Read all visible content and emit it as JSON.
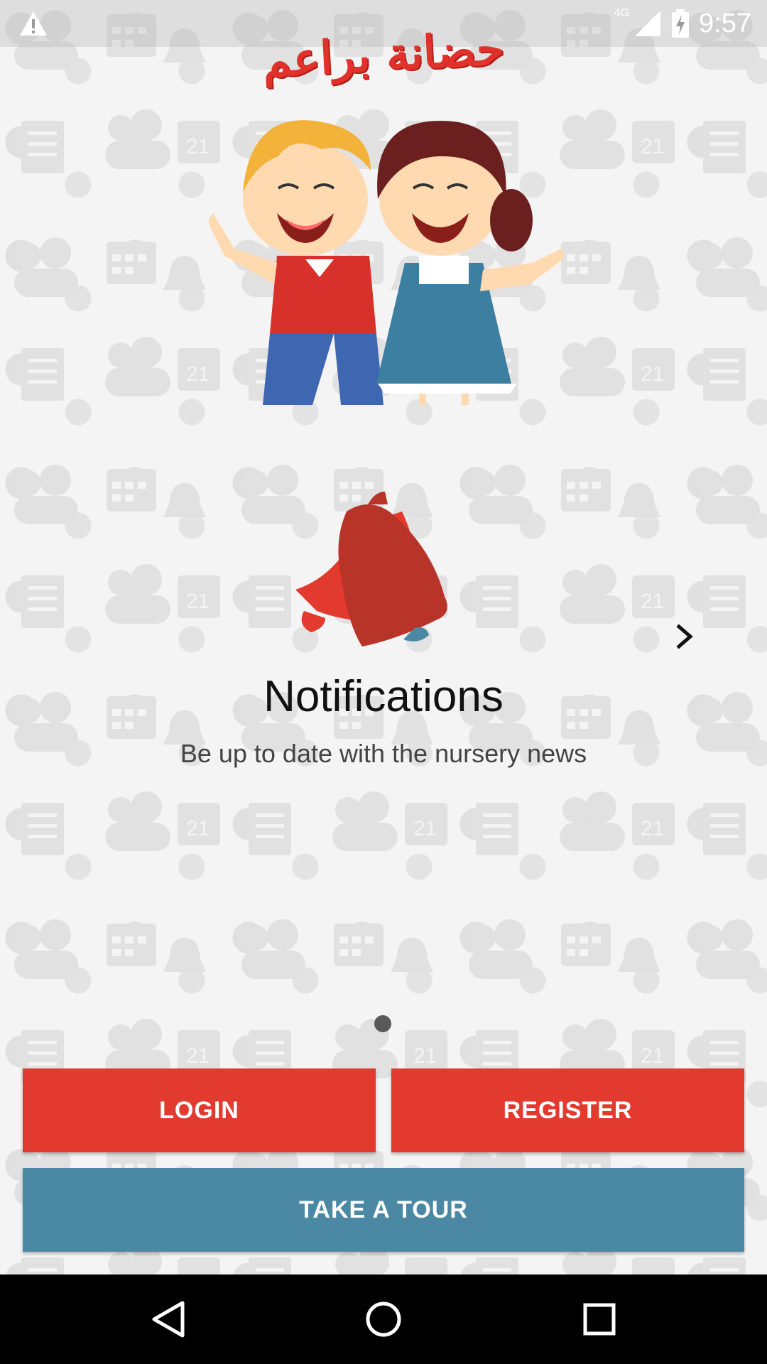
{
  "status_bar": {
    "network": "4G",
    "time": "9:57",
    "icons": [
      "warning-icon",
      "signal-icon",
      "battery-charging-icon"
    ]
  },
  "hero": {
    "app_title_ar": "حضانة براعم",
    "illustration": "kids-illustration"
  },
  "slide": {
    "icon": "bell-icon",
    "title": "Notifications",
    "subtitle": "Be up to date with the nursery news",
    "next_icon": "chevron-right-icon"
  },
  "pager": {
    "current": 1,
    "total": 1
  },
  "actions": {
    "login_label": "LOGIN",
    "register_label": "REGISTER",
    "tour_label": "TAKE A TOUR"
  },
  "nav": {
    "icons": [
      "back-icon",
      "home-icon",
      "recents-icon"
    ]
  },
  "colors": {
    "primary_red": "#e23a2e",
    "tour_blue": "#4a88a4",
    "bell_red": "#c8392b"
  }
}
